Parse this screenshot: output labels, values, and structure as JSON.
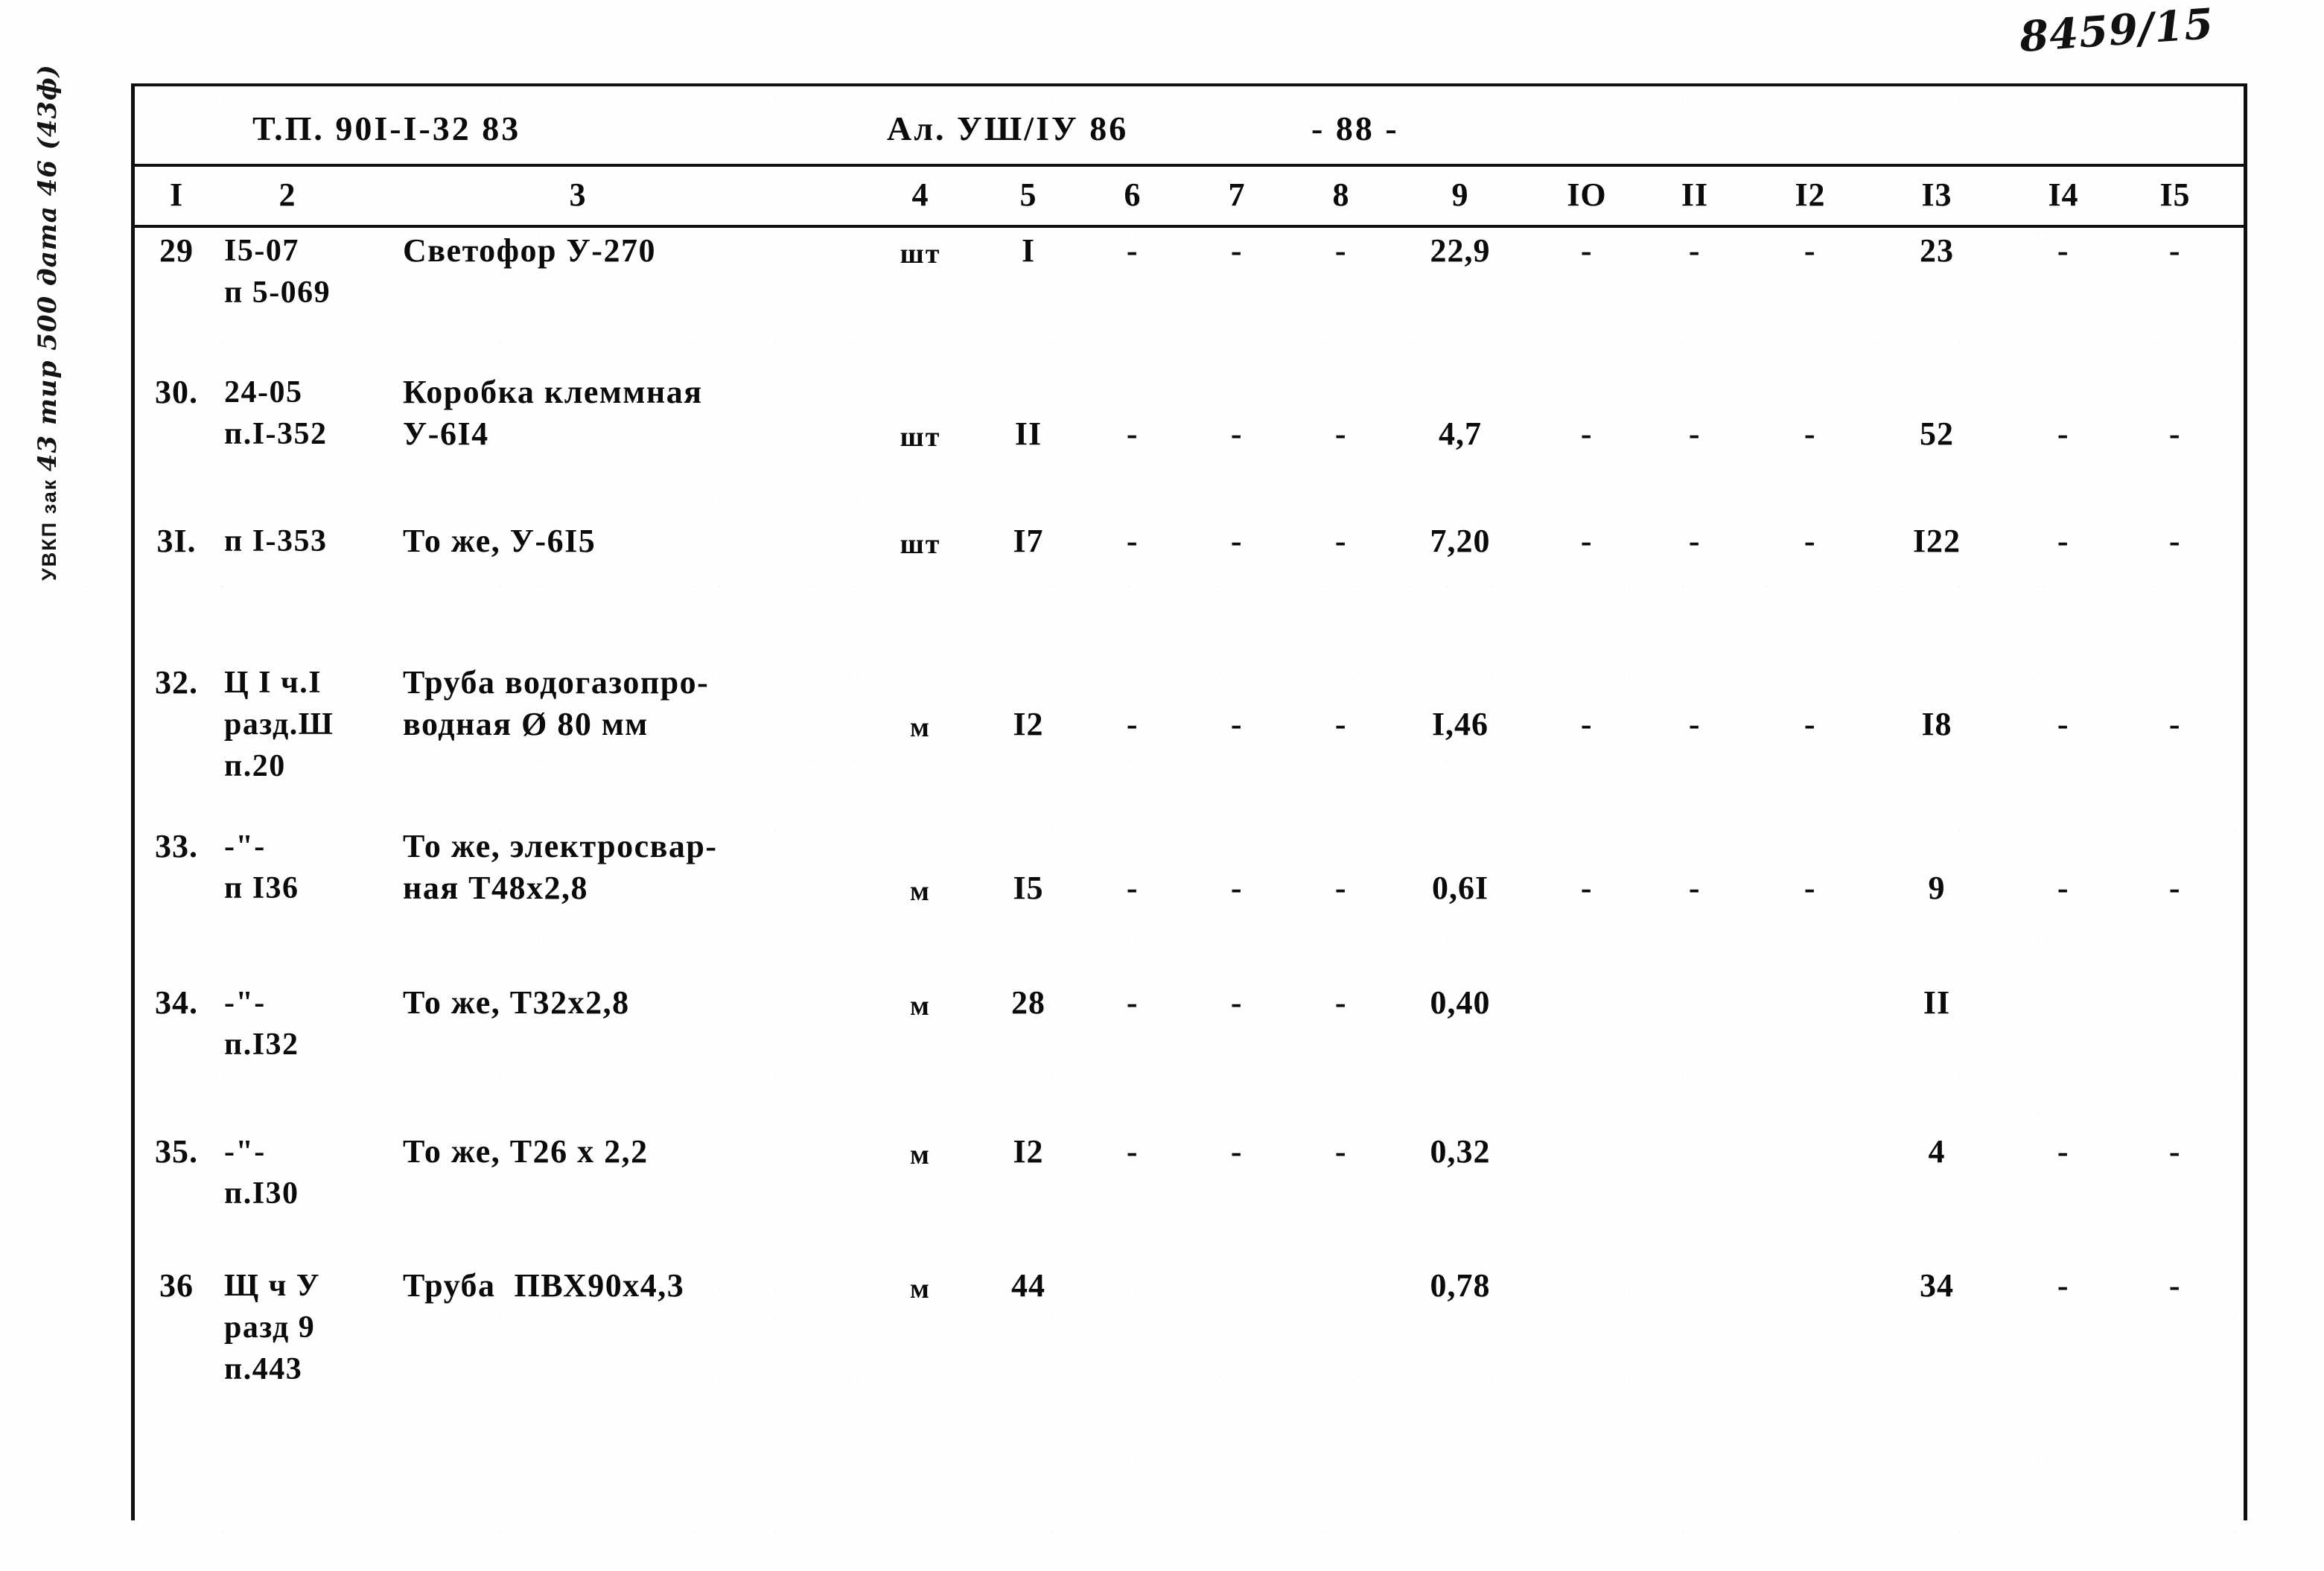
{
  "archive_mark": "8459/15",
  "left_imprint": {
    "printed": "УВКП  зак",
    "handwritten": "43  тир 500 дата 46 (43ф)"
  },
  "doc_header": {
    "type_project": "Т.П. 90I-I-32 83",
    "album": "Ал. УШ/IУ 86",
    "page": "- 88 -"
  },
  "column_numbers": [
    "I",
    "2",
    "3",
    "4",
    "5",
    "6",
    "7",
    "8",
    "9",
    "IO",
    "II",
    "I2",
    "I3",
    "I4",
    "I5"
  ],
  "rows": [
    {
      "no": "29",
      "code": [
        "I5-07",
        "п 5-069"
      ],
      "name": [
        "Светофор У-270"
      ],
      "unit": "шт",
      "c5": "I",
      "c6": "-",
      "c7": "-",
      "c8": "-",
      "c9": "22,9",
      "c10": "-",
      "c11": "-",
      "c12": "-",
      "c13": "23",
      "c14": "-",
      "c15": "-"
    },
    {
      "no": "30.",
      "code": [
        "24-05",
        "п.I-352"
      ],
      "name": [
        "Коробка клеммная",
        "У-6I4"
      ],
      "unit": "шт",
      "c5": "II",
      "c6": "-",
      "c7": "-",
      "c8": "-",
      "c9": "4,7",
      "c10": "-",
      "c11": "-",
      "c12": "-",
      "c13": "52",
      "c14": "-",
      "c15": "-"
    },
    {
      "no": "3I.",
      "code": [
        "п I-353"
      ],
      "name": [
        "То же, У-6I5"
      ],
      "unit": "шт",
      "c5": "I7",
      "c6": "-",
      "c7": "-",
      "c8": "-",
      "c9": "7,20",
      "c10": "-",
      "c11": "-",
      "c12": "-",
      "c13": "I22",
      "c14": "-",
      "c15": "-"
    },
    {
      "no": "32.",
      "code": [
        "Ц I ч.I",
        "разд.Ш",
        "п.20"
      ],
      "name": [
        "Труба водогазопро-",
        "водная Ø 80 мм"
      ],
      "unit": "м",
      "c5": "I2",
      "c6": "-",
      "c7": "-",
      "c8": "-",
      "c9": "I,46",
      "c10": "-",
      "c11": "-",
      "c12": "-",
      "c13": "I8",
      "c14": "-",
      "c15": "-"
    },
    {
      "no": "33.",
      "code": [
        "-\"-",
        "п I36"
      ],
      "name": [
        "То же, электросвар-",
        "ная Т48х2,8"
      ],
      "unit": "м",
      "c5": "I5",
      "c6": "-",
      "c7": "-",
      "c8": "-",
      "c9": "0,6I",
      "c10": "-",
      "c11": "-",
      "c12": "-",
      "c13": "9",
      "c14": "-",
      "c15": "-"
    },
    {
      "no": "34.",
      "code": [
        "-\"-",
        "п.I32"
      ],
      "name": [
        "То же, Т32х2,8"
      ],
      "unit": "м",
      "c5": "28",
      "c6": "-",
      "c7": "-",
      "c8": "-",
      "c9": "0,40",
      "c10": "",
      "c11": "",
      "c12": "",
      "c13": "II",
      "c14": "",
      "c15": ""
    },
    {
      "no": "35.",
      "code": [
        "-\"-",
        "п.I30"
      ],
      "name": [
        "То же, Т26 х 2,2"
      ],
      "unit": "м",
      "c5": "I2",
      "c6": "-",
      "c7": "-",
      "c8": "-",
      "c9": "0,32",
      "c10": "",
      "c11": "",
      "c12": "",
      "c13": "4",
      "c14": "-",
      "c15": "-"
    },
    {
      "no": "36",
      "code": [
        "Щ ч У",
        "разд 9",
        "п.443"
      ],
      "name": [
        "Труба  ПВХ90х4,3"
      ],
      "unit": "м",
      "c5": "44",
      "c6": "",
      "c7": "",
      "c8": "",
      "c9": "0,78",
      "c10": "",
      "c11": "",
      "c12": "",
      "c13": "34",
      "c14": "-",
      "c15": "-"
    }
  ]
}
